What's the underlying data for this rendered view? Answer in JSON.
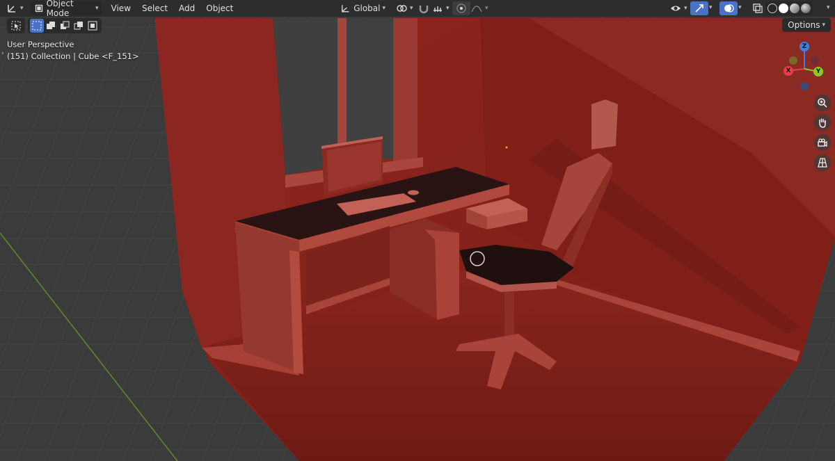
{
  "header": {
    "mode": "Object Mode",
    "menus": [
      "View",
      "Select",
      "Add",
      "Object"
    ],
    "orientation": "Global"
  },
  "viewport": {
    "view_name": "User Perspective",
    "collection_info": "(151) Collection | Cube <F_151>"
  },
  "options_label": "Options",
  "gizmo": {
    "z": "Z",
    "x": "X",
    "y": "Y"
  },
  "colors": {
    "accent": "#4a72c9",
    "room": "#8c231c",
    "grid_bg": "#3c3c3c",
    "axis_x": "#e4404e",
    "axis_y": "#8ac926",
    "axis_z": "#3d7ee8"
  },
  "icons": {
    "editor_type": "axes-icon",
    "mode_icon": "object-mode-icon",
    "transform_orientation": "orientation-icon",
    "pivot": "link-icon",
    "snap": "magnet-icon",
    "proportional": "proportional-edit-icon",
    "visibility": "eye-icon",
    "gizmos": "gizmo-icon",
    "overlays": "overlay-icon",
    "xray": "xray-icon",
    "zoom": "zoom-icon",
    "pan": "hand-icon",
    "camera": "camera-icon",
    "perspective": "grid-icon"
  }
}
